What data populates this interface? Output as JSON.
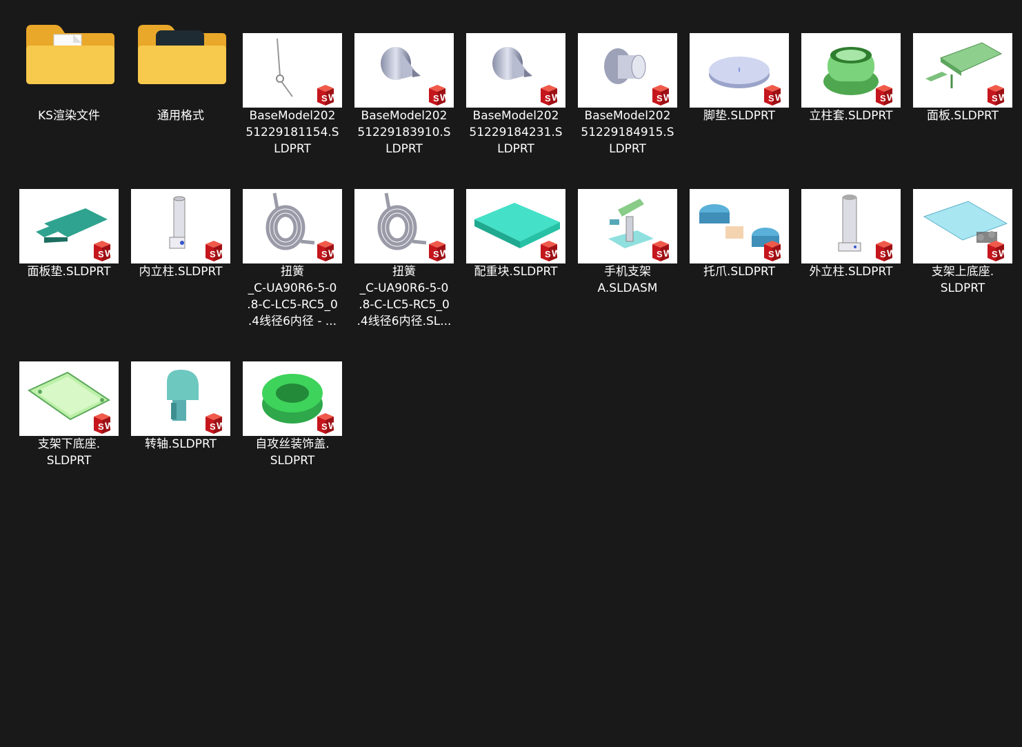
{
  "colors": {
    "background": "#191919",
    "label_text": "#ffffff",
    "folder_yellow": "#f4c54a",
    "sw_red": "#d32525"
  },
  "items": [
    {
      "name": "KS渲染文件",
      "type": "folder",
      "icon": "folder-document-icon"
    },
    {
      "name": "通用格式",
      "type": "folder",
      "icon": "folder-cad-icon"
    },
    {
      "name": "BaseModel20251229181154.SLDPRT",
      "label": "BaseModel20251229181154.SLDPRT",
      "icon": "wire-rod-icon"
    },
    {
      "name": "BaseModel20251229183910.SLDPRT",
      "label": "BaseModel20251229183910.SLDPRT",
      "icon": "cone-screw-icon"
    },
    {
      "name": "BaseModel20251229184231.SLDPRT",
      "label": "BaseModel20251229184231.SLDPRT",
      "icon": "cone-screw-icon"
    },
    {
      "name": "BaseModel20251229184915.SLDPRT",
      "label": "BaseModel20251229184915.SLDPRT",
      "icon": "flanged-cylinder-icon"
    },
    {
      "name": "脚垫.SLDPRT",
      "label": "脚垫.SLDPRT",
      "icon": "disc-pad-icon"
    },
    {
      "name": "立柱套.SLDPRT",
      "label": "立柱套.SLDPRT",
      "icon": "green-sleeve-icon"
    },
    {
      "name": "面板.SLDPRT",
      "label": "面板.SLDPRT",
      "icon": "green-panel-icon"
    },
    {
      "name": "面板垫.SLDPRT",
      "label": "面板垫.SLDPRT",
      "icon": "teal-pad-icon"
    },
    {
      "name": "内立柱.SLDPRT",
      "label": "内立柱.SLDPRT",
      "icon": "inner-column-icon"
    },
    {
      "name": "扭簧_C-UA90R6-5-0.8-C-LC5-RC5_0.4线径6内径 - ...",
      "label": "扭簧_C-UA90R6-5-0.8-C-LC5-RC5_0.4线径6内径 - ...",
      "icon": "torsion-spring-icon"
    },
    {
      "name": "扭簧_C-UA90R6-5-0.8-C-LC5-RC5_0.4线径6内径.SL...",
      "label": "扭簧_C-UA90R6-5-0.8-C-LC5-RC5_0.4线径6内径.SL...",
      "icon": "torsion-spring-icon"
    },
    {
      "name": "配重块.SLDPRT",
      "label": "配重块.SLDPRT",
      "icon": "cyan-block-icon"
    },
    {
      "name": "手机支架A.SLDASM",
      "label": "手机支架A.SLDASM",
      "icon": "phone-stand-assembly-icon"
    },
    {
      "name": "托爪.SLDPRT",
      "label": "托爪.SLDPRT",
      "icon": "claw-icon"
    },
    {
      "name": "外立柱.SLDPRT",
      "label": "外立柱.SLDPRT",
      "icon": "outer-column-icon"
    },
    {
      "name": "支架上底座.SLDPRT",
      "label": "支架上底座.SLDPRT",
      "icon": "upper-base-icon"
    },
    {
      "name": "支架下底座.SLDPRT",
      "label": "支架下底座.SLDPRT",
      "icon": "lower-base-icon"
    },
    {
      "name": "转轴.SLDPRT",
      "label": "转轴.SLDPRT",
      "icon": "pivot-shaft-icon"
    },
    {
      "name": "自攻丝装饰盖.SLDPRT",
      "label": "自攻丝装饰盖.SLDPRT",
      "icon": "green-ring-icon"
    }
  ],
  "label_lines": {
    "0": [
      "KS渲染文件"
    ],
    "1": [
      "通用格式"
    ],
    "2": [
      "BaseModel202",
      "51229181154.S",
      "LDPRT"
    ],
    "3": [
      "BaseModel202",
      "51229183910.S",
      "LDPRT"
    ],
    "4": [
      "BaseModel202",
      "51229184231.S",
      "LDPRT"
    ],
    "5": [
      "BaseModel202",
      "51229184915.S",
      "LDPRT"
    ],
    "6": [
      "脚垫.SLDPRT"
    ],
    "7": [
      "立柱套.SLDPRT"
    ],
    "8": [
      "面板.SLDPRT"
    ],
    "9": [
      "面板垫.SLDPRT"
    ],
    "10": [
      "内立柱.SLDPRT"
    ],
    "11": [
      "扭簧",
      "_C-UA90R6-5-0",
      ".8-C-LC5-RC5_0",
      ".4线径6内径 - ..."
    ],
    "12": [
      "扭簧",
      "_C-UA90R6-5-0",
      ".8-C-LC5-RC5_0",
      ".4线径6内径.SL..."
    ],
    "13": [
      "配重块.SLDPRT"
    ],
    "14": [
      "手机支架",
      "A.SLDASM"
    ],
    "15": [
      "托爪.SLDPRT"
    ],
    "16": [
      "外立柱.SLDPRT"
    ],
    "17": [
      "支架上底座.",
      "SLDPRT"
    ],
    "18": [
      "支架下底座.",
      "SLDPRT"
    ],
    "19": [
      "转轴.SLDPRT"
    ],
    "20": [
      "自攻丝装饰盖.",
      "SLDPRT"
    ]
  }
}
